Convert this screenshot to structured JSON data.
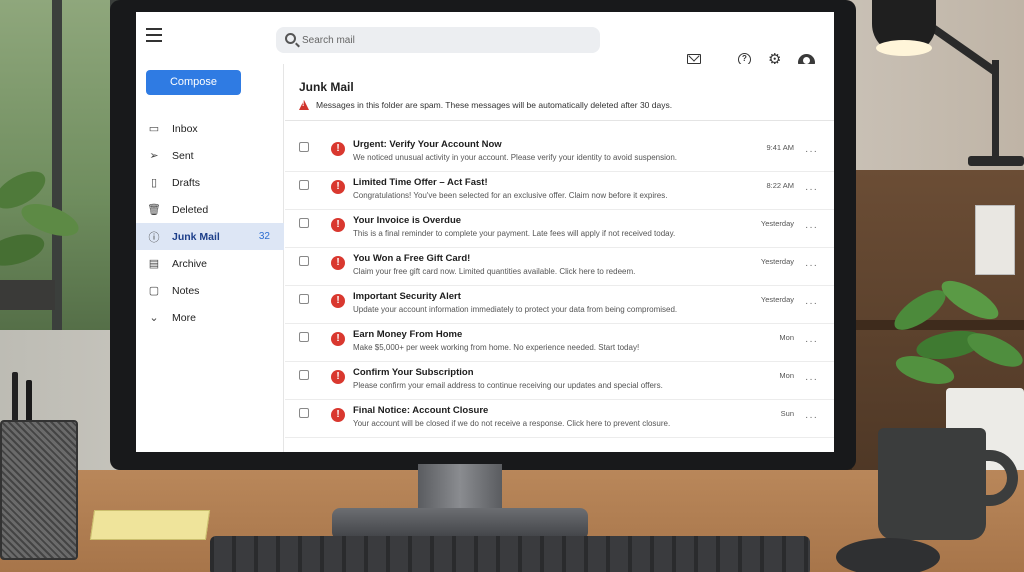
{
  "search": {
    "placeholder": "Search mail"
  },
  "sidebar": {
    "compose_label": "Compose",
    "items": [
      {
        "label": "Inbox",
        "icon": "inbox-icon",
        "count": ""
      },
      {
        "label": "Sent",
        "icon": "send-icon",
        "count": ""
      },
      {
        "label": "Drafts",
        "icon": "draft-icon",
        "count": ""
      },
      {
        "label": "Deleted",
        "icon": "trash-icon",
        "count": ""
      },
      {
        "label": "Junk Mail",
        "icon": "junk-icon",
        "count": "32",
        "active": true
      },
      {
        "label": "Archive",
        "icon": "archive-icon",
        "count": ""
      },
      {
        "label": "Notes",
        "icon": "notes-icon",
        "count": ""
      },
      {
        "label": "More",
        "icon": "chevron-down-icon",
        "count": ""
      }
    ]
  },
  "main": {
    "folder_title": "Junk Mail",
    "warning": "Messages in this folder are spam. These messages will be automatically deleted after 30 days.",
    "messages": [
      {
        "subject": "Urgent: Verify Your Account Now",
        "preview": "We noticed unusual activity in your account. Please verify your identity to avoid suspension.",
        "time": "9:41 AM"
      },
      {
        "subject": "Limited Time Offer – Act Fast!",
        "preview": "Congratulations! You've been selected for an exclusive offer. Claim now before it expires.",
        "time": "8:22 AM"
      },
      {
        "subject": "Your Invoice is Overdue",
        "preview": "This is a final reminder to complete your payment. Late fees will apply if not received today.",
        "time": "Yesterday"
      },
      {
        "subject": "You Won a Free Gift Card!",
        "preview": "Claim your free gift card now. Limited quantities available. Click here to redeem.",
        "time": "Yesterday"
      },
      {
        "subject": "Important Security Alert",
        "preview": "Update your account information immediately to protect your data from being compromised.",
        "time": "Yesterday"
      },
      {
        "subject": "Earn Money From Home",
        "preview": "Make $5,000+ per week working from home. No experience needed. Start today!",
        "time": "Mon"
      },
      {
        "subject": "Confirm Your Subscription",
        "preview": "Please confirm your email address to continue receiving our updates and special offers.",
        "time": "Mon"
      },
      {
        "subject": "Final Notice: Account Closure",
        "preview": "Your account will be closed if we do not receive a response. Click here to prevent closure.",
        "time": "Sun"
      }
    ]
  },
  "colors": {
    "accent": "#2f7be3",
    "spam": "#d9382f",
    "active_nav": "#dde6f5"
  }
}
